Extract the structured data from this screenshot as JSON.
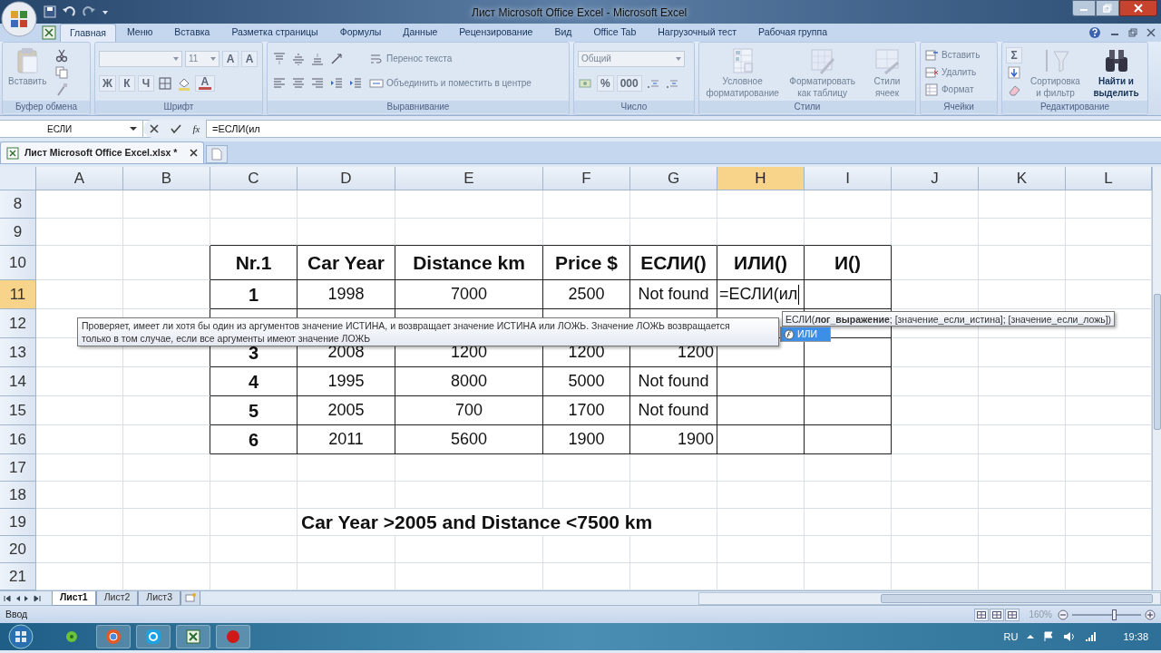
{
  "window": {
    "title": "Лист Microsoft Office Excel - Microsoft Excel"
  },
  "ribbon_tabs": [
    {
      "label": "Главная",
      "selected": true
    },
    {
      "label": "Меню",
      "selected": false
    },
    {
      "label": "Вставка",
      "selected": false
    },
    {
      "label": "Разметка страницы",
      "selected": false
    },
    {
      "label": "Формулы",
      "selected": false
    },
    {
      "label": "Данные",
      "selected": false
    },
    {
      "label": "Рецензирование",
      "selected": false
    },
    {
      "label": "Вид",
      "selected": false
    },
    {
      "label": "Office Tab",
      "selected": false
    },
    {
      "label": "Нагрузочный тест",
      "selected": false
    },
    {
      "label": "Рабочая группа",
      "selected": false
    }
  ],
  "ribbon_groups": [
    {
      "label": "Буфер обмена",
      "blocks": [
        {
          "kind": "paste",
          "label": "Вставить",
          "disabled": true
        },
        {
          "kind": "stack",
          "rows": [
            [
              {
                "kind": "cut"
              }
            ],
            [
              {
                "kind": "copy"
              }
            ],
            [
              {
                "kind": "brush"
              }
            ]
          ]
        }
      ]
    },
    {
      "label": "Шрифт",
      "blocks": [
        {
          "kind": "stack",
          "rows": [
            [
              {
                "kind": "combo-wide"
              },
              {
                "kind": "combo",
                "text": "11"
              },
              {
                "kind": "text",
                "text": "A"
              },
              {
                "kind": "text",
                "text": "A"
              }
            ],
            [
              {
                "kind": "text",
                "text": "Ж"
              },
              {
                "kind": "text",
                "text": "К"
              },
              {
                "kind": "text",
                "text": "Ч"
              },
              {
                "kind": "borders"
              },
              {
                "kind": "fill"
              },
              {
                "kind": "font-color",
                "text": "A"
              }
            ]
          ]
        }
      ]
    },
    {
      "label": "Выравнивание",
      "blocks": [
        {
          "kind": "stack",
          "rows": [
            [
              {
                "kind": "align-top"
              },
              {
                "kind": "align-middle"
              },
              {
                "kind": "align-bottom"
              },
              {
                "kind": "orientation"
              }
            ],
            [
              {
                "kind": "align-left"
              },
              {
                "kind": "align-center"
              },
              {
                "kind": "align-right"
              },
              {
                "kind": "indent"
              },
              {
                "kind": "indent"
              }
            ]
          ]
        },
        {
          "kind": "stack",
          "rows": [
            [
              {
                "kind": "wrap",
                "label": "Перенос текста"
              }
            ],
            [
              {
                "kind": "merge",
                "label": "Объединить и поместить в центре"
              }
            ]
          ]
        }
      ]
    },
    {
      "label": "Число",
      "blocks": [
        {
          "kind": "stack",
          "rows": [
            [
              {
                "kind": "combo-wide",
                "text": "Общий"
              }
            ],
            [
              {
                "kind": "currency"
              },
              {
                "kind": "text",
                "text": "%"
              },
              {
                "kind": "text",
                "text": "000"
              },
              {
                "kind": "decimal"
              },
              {
                "kind": "decimal"
              }
            ]
          ]
        }
      ]
    },
    {
      "label": "Стили",
      "blocks": [
        {
          "kind": "conditional-format",
          "label": "Условное форматирование",
          "disabled": true
        },
        {
          "kind": "format-table",
          "label": "Форматировать как таблицу",
          "disabled": true
        },
        {
          "kind": "cell-styles",
          "label": "Стили ячеек",
          "disabled": true
        }
      ]
    },
    {
      "label": "Ячейки",
      "blocks": [
        {
          "kind": "stack",
          "rows": [
            [
              {
                "kind": "insert-cells",
                "label": "Вставить"
              }
            ],
            [
              {
                "kind": "delete-cells",
                "label": "Удалить"
              }
            ],
            [
              {
                "kind": "format-cells",
                "label": "Формат"
              }
            ]
          ]
        }
      ]
    },
    {
      "label": "Редактирование",
      "blocks": [
        {
          "kind": "stack",
          "rows": [
            [
              {
                "kind": "text",
                "text": "Σ"
              }
            ],
            [
              {
                "kind": "fill-down"
              }
            ],
            [
              {
                "kind": "eraser"
              }
            ]
          ]
        },
        {
          "kind": "sort",
          "label": "Сортировка и фильтр",
          "disabled": true
        },
        {
          "kind": "find",
          "label": "Найти и выделить",
          "disabled": false
        }
      ]
    }
  ],
  "formula_bar": {
    "name_box": "ЕСЛИ",
    "function_button": "fx",
    "formula": "=ЕСЛИ(ил"
  },
  "document_tab": {
    "label": "Лист Microsoft Office Excel.xlsx *"
  },
  "sheet": {
    "columns": [
      {
        "label": "A",
        "selected": false
      },
      {
        "label": "B",
        "selected": false
      },
      {
        "label": "C",
        "selected": false
      },
      {
        "label": "D",
        "selected": false
      },
      {
        "label": "E",
        "selected": false
      },
      {
        "label": "F",
        "selected": false
      },
      {
        "label": "G",
        "selected": false
      },
      {
        "label": "H",
        "selected": true
      },
      {
        "label": "I",
        "selected": false
      },
      {
        "label": "J",
        "selected": false
      },
      {
        "label": "K",
        "selected": false
      },
      {
        "label": "L",
        "selected": false
      }
    ],
    "rows": [
      {
        "label": "8",
        "selected": false
      },
      {
        "label": "9",
        "selected": false
      },
      {
        "label": "10",
        "selected": false
      },
      {
        "label": "11",
        "selected": true
      },
      {
        "label": "12",
        "selected": false
      },
      {
        "label": "13",
        "selected": false
      },
      {
        "label": "14",
        "selected": false
      },
      {
        "label": "15",
        "selected": false
      },
      {
        "label": "16",
        "selected": false
      },
      {
        "label": "17",
        "selected": false
      },
      {
        "label": "18",
        "selected": false
      },
      {
        "label": "19",
        "selected": false
      },
      {
        "label": "20",
        "selected": false
      },
      {
        "label": "21",
        "selected": false
      }
    ],
    "table": {
      "header": [
        "Nr.1",
        "Car Year",
        "Distance km",
        "Price $",
        "ЕСЛИ()",
        "ИЛИ()",
        "И()"
      ],
      "rows": [
        {
          "cells": [
            {
              "text": "1"
            },
            {
              "text": "1998"
            },
            {
              "text": "7000"
            },
            {
              "text": "2500"
            },
            {
              "text": "Not found",
              "right_aligned": false
            },
            {
              "text": "=ЕСЛИ(ил",
              "editing": true
            }
          ]
        },
        {
          "covered": true
        },
        {
          "cells": [
            {
              "text": "3"
            },
            {
              "text": "2008"
            },
            {
              "text": "1200"
            },
            {
              "text": "1200"
            },
            {
              "text": "1200",
              "right_aligned": true
            }
          ]
        },
        {
          "cells": [
            {
              "text": "4"
            },
            {
              "text": "1995"
            },
            {
              "text": "8000"
            },
            {
              "text": "5000"
            },
            {
              "text": "Not found",
              "right_aligned": false
            }
          ]
        },
        {
          "cells": [
            {
              "text": "5"
            },
            {
              "text": "2005"
            },
            {
              "text": "700"
            },
            {
              "text": "1700"
            },
            {
              "text": "Not found",
              "right_aligned": false
            }
          ]
        },
        {
          "cells": [
            {
              "text": "6"
            },
            {
              "text": "2011"
            },
            {
              "text": "5600"
            },
            {
              "text": "1900"
            },
            {
              "text": "1900",
              "right_aligned": true
            }
          ]
        }
      ]
    },
    "note": "Car Year >2005 and Distance <7500 km"
  },
  "function_tooltip": {
    "description": "Проверяет, имеет ли хотя бы один из аргументов значение ИСТИНА, и возвращает значение ИСТИНА или ЛОЖЬ. Значение ЛОЖЬ возвращается только в том случае, если все аргументы имеют значение ЛОЖЬ",
    "syntax": "ЕСЛИ(**лог_выражение**; [значение_если_истина]; [значение_если_ложь])"
  },
  "autocomplete": [
    {
      "label": "ИЛИ",
      "selected": true
    }
  ],
  "sheet_tabs": [
    {
      "label": "Лист1",
      "selected": true
    },
    {
      "label": "Лист2",
      "selected": false
    },
    {
      "label": "Лист3",
      "selected": false
    }
  ],
  "status_bar": {
    "mode": "Ввод",
    "zoom": "160%",
    "zoom_slider": {
      "level": 0.6
    }
  },
  "taskbar": {
    "language": "RU",
    "clock": "19:38"
  }
}
